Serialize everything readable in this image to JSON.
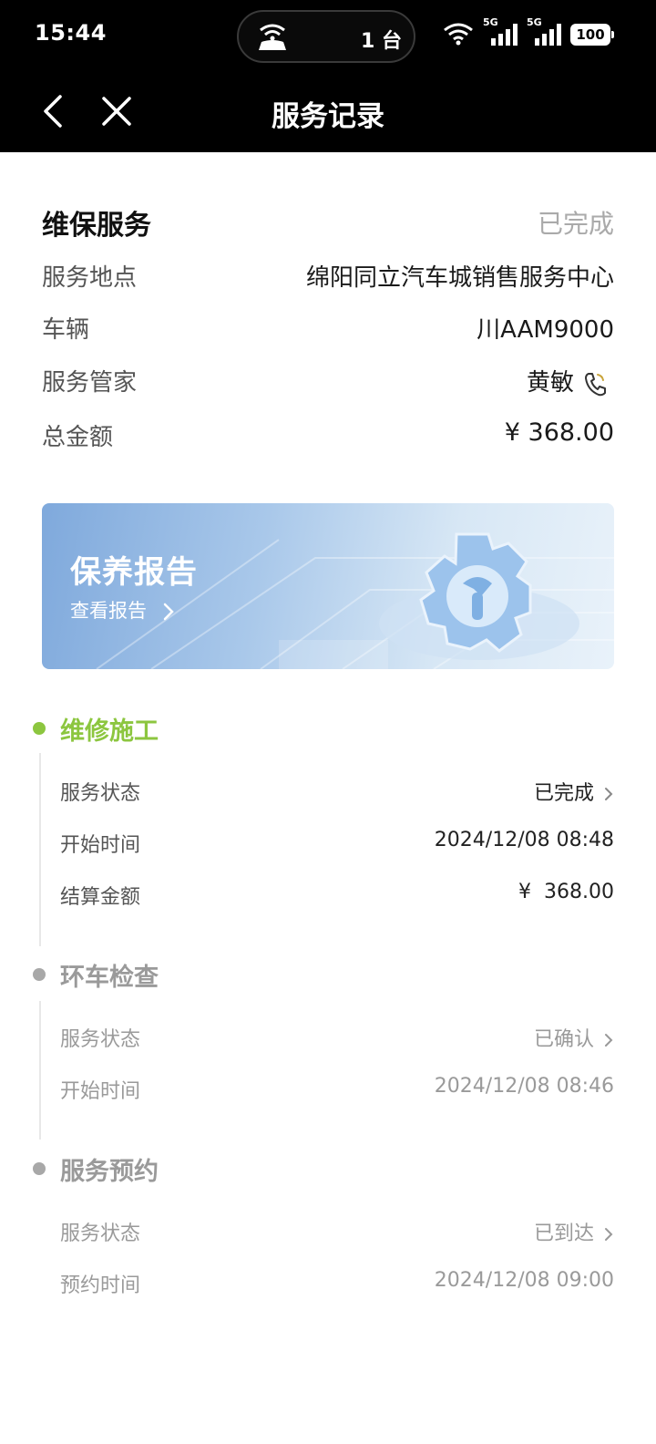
{
  "status_bar": {
    "time": "15:44",
    "pill_text": "1 台",
    "signal1": "5G",
    "signal2": "5G",
    "battery": "100"
  },
  "nav": {
    "title": "服务记录",
    "back_icon": "chevron-left-icon",
    "close_icon": "close-icon"
  },
  "summary": {
    "title": "维保服务",
    "status": "已完成",
    "rows": [
      {
        "label": "服务地点",
        "value": "绵阳同立汽车城销售服务中心"
      },
      {
        "label": "车辆",
        "value": "川AAM9000"
      },
      {
        "label": "服务管家",
        "value": "黄敏"
      },
      {
        "label": "总金额",
        "value": "¥ 368.00"
      }
    ]
  },
  "banner": {
    "title": "保养报告",
    "link": "查看报告"
  },
  "timeline": [
    {
      "title": "维修施工",
      "rows": [
        {
          "label": "服务状态",
          "value": "已完成"
        },
        {
          "label": "开始时间",
          "value": "2024/12/08 08:48"
        },
        {
          "label": "结算金额",
          "value": "¥  368.00"
        }
      ]
    },
    {
      "title": "环车检查",
      "rows": [
        {
          "label": "服务状态",
          "value": "已确认"
        },
        {
          "label": "开始时间",
          "value": "2024/12/08 08:46"
        }
      ]
    },
    {
      "title": "服务预约",
      "rows": [
        {
          "label": "服务状态",
          "value": "已到达"
        },
        {
          "label": "预约时间",
          "value": "2024/12/08 09:00"
        }
      ]
    }
  ],
  "colors": {
    "accent_green": "#8cc63f",
    "muted_grey": "#9a9a9a",
    "dot_grey": "#a8a8a8"
  }
}
